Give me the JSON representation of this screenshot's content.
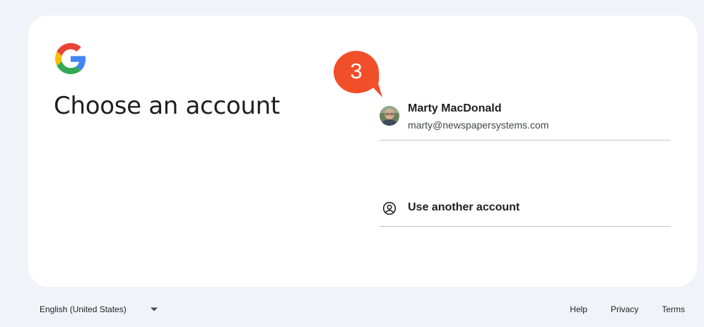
{
  "page": {
    "title": "Choose an account"
  },
  "logo": {
    "icon": "google-g-logo-icon"
  },
  "step_badge": {
    "number": "3",
    "color": "#f14e2a"
  },
  "accounts": [
    {
      "name": "Marty MacDonald",
      "email": "marty@newspapersystems.com",
      "icon": "user-avatar-icon"
    }
  ],
  "another_account": {
    "label": "Use another account",
    "icon": "account-circle-icon"
  },
  "footer": {
    "language": "English (United States)",
    "language_icon": "dropdown-arrow-icon",
    "links": [
      "Help",
      "Privacy",
      "Terms"
    ]
  },
  "colors": {
    "background": "#f0f4f9",
    "card": "#ffffff",
    "text": "#1f1f1f",
    "divider": "#c4c7c5",
    "badge": "#f14e2a"
  }
}
